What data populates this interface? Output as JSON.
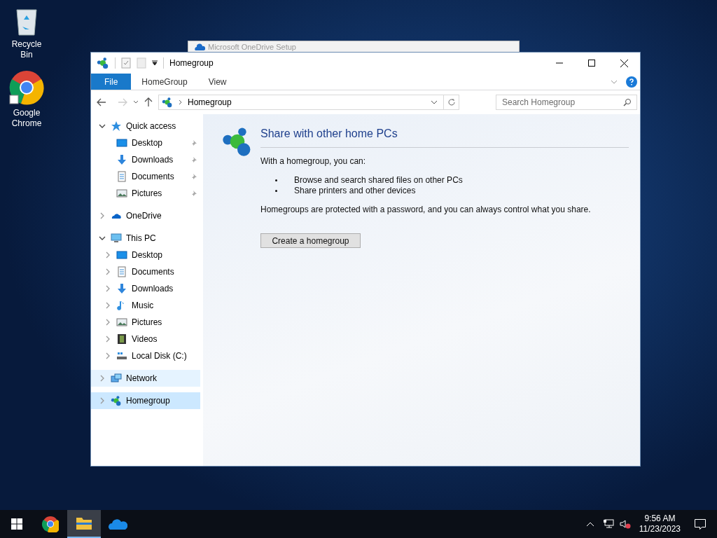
{
  "desktop_icons": [
    {
      "kind": "recycle",
      "label": "Recycle Bin"
    },
    {
      "kind": "chrome",
      "label": "Google Chrome"
    }
  ],
  "background_window": {
    "title": "Microsoft OneDrive Setup"
  },
  "window": {
    "title": "Homegroup"
  },
  "ribbon_tabs": [
    {
      "kind": "file",
      "label": "File"
    },
    {
      "kind": "tab",
      "label": "HomeGroup"
    },
    {
      "kind": "tab",
      "label": "View"
    }
  ],
  "address_bar": {
    "path": "Homegroup"
  },
  "search": {
    "placeholder": "Search Homegroup"
  },
  "sidebar": {
    "items": [
      {
        "kind": "star",
        "label": "Quick access",
        "expanded": true,
        "selected": false,
        "hovered": false,
        "children": [
          {
            "kind": "desktop",
            "label": "Desktop",
            "pinned": true,
            "selected": false
          },
          {
            "kind": "download",
            "label": "Downloads",
            "pinned": true,
            "selected": false
          },
          {
            "kind": "document",
            "label": "Documents",
            "pinned": true,
            "selected": false
          },
          {
            "kind": "picture",
            "label": "Pictures",
            "pinned": true,
            "selected": false
          }
        ]
      },
      {
        "kind": "cloud",
        "label": "OneDrive",
        "expanded": false,
        "selected": false,
        "hovered": false
      },
      {
        "kind": "pc",
        "label": "This PC",
        "expanded": true,
        "selected": false,
        "hovered": false,
        "children": [
          {
            "kind": "desktop",
            "label": "Desktop",
            "pinned": false,
            "selected": false
          },
          {
            "kind": "document",
            "label": "Documents",
            "pinned": false,
            "selected": false
          },
          {
            "kind": "download",
            "label": "Downloads",
            "pinned": false,
            "selected": false
          },
          {
            "kind": "music",
            "label": "Music",
            "pinned": false,
            "selected": false
          },
          {
            "kind": "picture",
            "label": "Pictures",
            "pinned": false,
            "selected": false
          },
          {
            "kind": "video",
            "label": "Videos",
            "pinned": false,
            "selected": false
          },
          {
            "kind": "disk",
            "label": "Local Disk (C:)",
            "pinned": false,
            "selected": false
          }
        ]
      },
      {
        "kind": "network",
        "label": "Network",
        "expanded": false,
        "selected": false,
        "hovered": true
      },
      {
        "kind": "homegroup",
        "label": "Homegroup",
        "expanded": false,
        "selected": true,
        "hovered": false
      }
    ]
  },
  "content": {
    "heading": "Share with other home PCs",
    "intro": "With a homegroup, you can:",
    "bullets": [
      "Browse and search shared files on other PCs",
      "Share printers and other devices"
    ],
    "note": "Homegroups are protected with a password, and you can always control what you share.",
    "button": "Create a homegroup"
  },
  "taskbar": {
    "apps": [
      {
        "kind": "chrome",
        "selected": false
      },
      {
        "kind": "explorer",
        "selected": true
      },
      {
        "kind": "onedrive",
        "selected": false
      }
    ],
    "time": "9:56 AM",
    "date": "11/23/2023"
  }
}
